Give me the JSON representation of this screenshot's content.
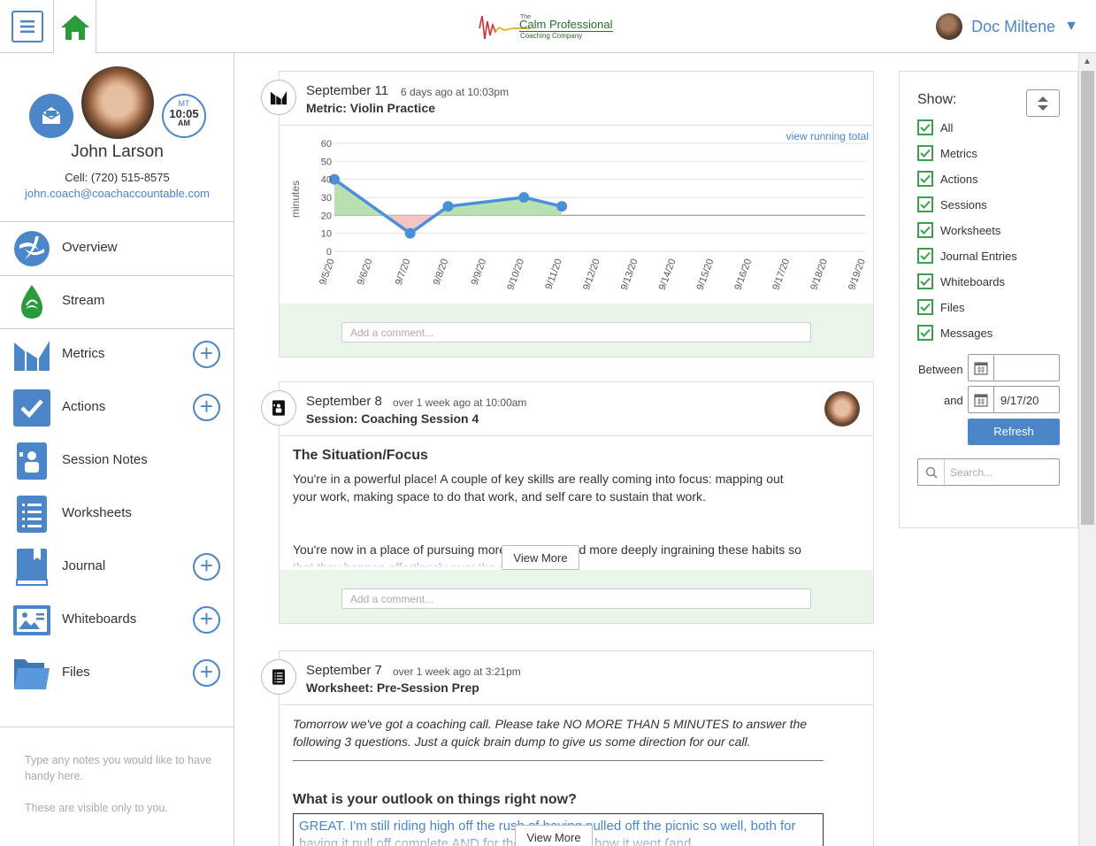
{
  "header": {
    "logo": {
      "small": "The",
      "main": "Calm Professional",
      "sub": "Coaching Company"
    },
    "user_name": "Doc Miltene",
    "caret": "▼"
  },
  "profile": {
    "timezone": "MT",
    "time": "10:05",
    "ampm": "AM",
    "name": "John Larson",
    "cell": "Cell: (720) 515-8575",
    "email": "john.coach@coachaccountable.com"
  },
  "nav": {
    "overview": "Overview",
    "stream": "Stream",
    "metrics": "Metrics",
    "actions": "Actions",
    "session_notes": "Session Notes",
    "worksheets": "Worksheets",
    "journal": "Journal",
    "whiteboards": "Whiteboards",
    "files": "Files",
    "plus": "+"
  },
  "notes": {
    "line1": "Type any notes you would like to have handy here.",
    "line2": "These are visible only to you."
  },
  "cards": {
    "metric": {
      "date": "September 11",
      "ago": "6 days ago at 10:03pm",
      "title": "Metric: Violin Practice",
      "running_total": "view running total",
      "comment_placeholder": "Add a comment..."
    },
    "session": {
      "date": "September 8",
      "ago": "over 1 week ago at 10:00am",
      "title": "Session: Coaching Session 4",
      "heading": "The Situation/Focus",
      "para1": "You're in a powerful place!  A couple of key skills are really coming into focus: mapping out your work, making space to do that work, and self care to sustain that work.",
      "para2": "You're now in a place of pursuing more and more and more deeply ingraining these habits so that they happen effortlessly over the next month.",
      "view_more": "View More",
      "comment_placeholder": "Add a comment..."
    },
    "worksheet": {
      "date": "September 7",
      "ago": "over 1 week ago at 3:21pm",
      "title": "Worksheet: Pre-Session Prep",
      "intro": "Tomorrow we've got a coaching call.  Please take NO MORE THAN 5 MINUTES to answer the following 3 questions.  Just a quick brain dump to give us some direction for our call.",
      "question": "What is your outlook on things right now?",
      "answer": "GREAT.  I'm still riding high off the rush of having pulled off the picnic so well, both for having it pull off complete AND for the good about how it went (and",
      "view_more": "View More"
    }
  },
  "filters": {
    "show_label": "Show:",
    "items": [
      "All",
      "Metrics",
      "Actions",
      "Sessions",
      "Worksheets",
      "Journal Entries",
      "Whiteboards",
      "Files",
      "Messages"
    ],
    "between_label": "Between",
    "and_label": "and",
    "from_value": "",
    "to_value": "9/17/20",
    "refresh_label": "Refresh",
    "search_placeholder": "Search..."
  },
  "chart_data": {
    "type": "line",
    "ylabel": "minutes",
    "ylim": [
      0,
      60
    ],
    "yticks": [
      0,
      10,
      20,
      30,
      40,
      50,
      60
    ],
    "baseline": 20,
    "categories": [
      "9/5/20",
      "9/6/20",
      "9/7/20",
      "9/8/20",
      "9/9/20",
      "9/10/20",
      "9/11/20",
      "9/12/20",
      "9/13/20",
      "9/14/20",
      "9/15/20",
      "9/16/20",
      "9/17/20",
      "9/18/20",
      "9/19/20"
    ],
    "points": [
      {
        "x": "9/5/20",
        "y": 40
      },
      {
        "x": "9/7/20",
        "y": 10
      },
      {
        "x": "9/8/20",
        "y": 25
      },
      {
        "x": "9/10/20",
        "y": 30
      },
      {
        "x": "9/11/20",
        "y": 25
      }
    ],
    "colors": {
      "line": "#4a90d9",
      "above": "#b8e0b0",
      "below": "#f3c4c4",
      "baseline": "#999999"
    }
  }
}
